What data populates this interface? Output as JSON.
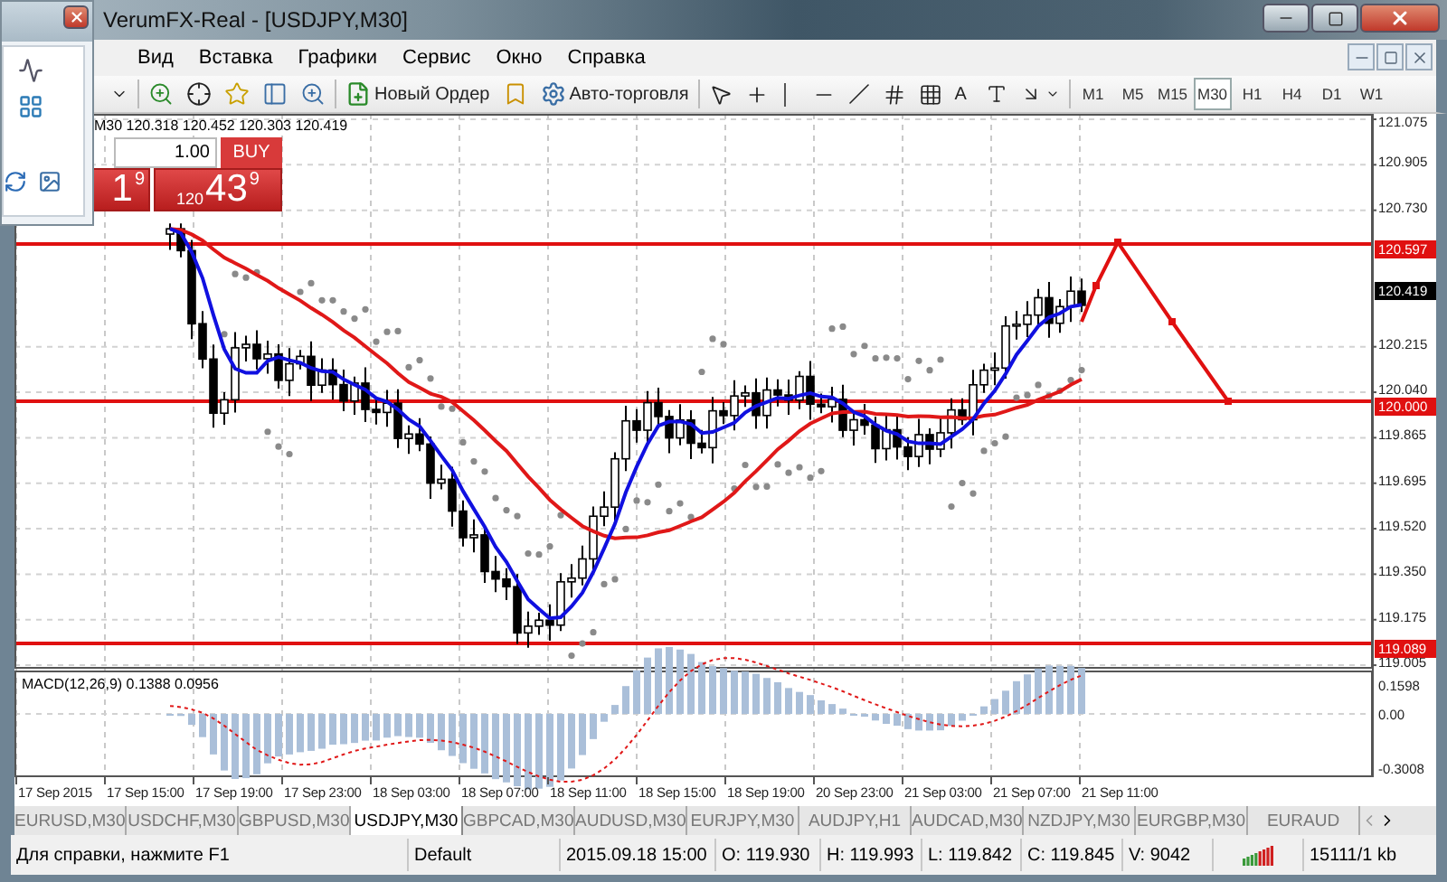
{
  "window": {
    "title": "VerumFX-Real - [USDJPY,M30]"
  },
  "menu": [
    "Вид",
    "Вставка",
    "Графики",
    "Сервис",
    "Окно",
    "Справка"
  ],
  "toolbar": {
    "new_order": "Новый Ордер",
    "auto_trading": "Авто-торговля",
    "text_tool": "A",
    "timeframes": [
      {
        "label": "M1",
        "selected": false
      },
      {
        "label": "M5",
        "selected": false
      },
      {
        "label": "M15",
        "selected": false
      },
      {
        "label": "M30",
        "selected": true
      },
      {
        "label": "H1",
        "selected": false
      },
      {
        "label": "H4",
        "selected": false
      },
      {
        "label": "D1",
        "selected": false
      },
      {
        "label": "W1",
        "selected": false
      }
    ]
  },
  "chart": {
    "info": "M30 120.318 120.452 120.303 120.419",
    "one_click": {
      "volume": "1.00",
      "buy_label": "BUY",
      "sell_price": {
        "big": "1",
        "pip": "9"
      },
      "buy_price": {
        "prefix": "120",
        "big": "43",
        "pip": "9"
      }
    },
    "price_ticks": [
      "121.075",
      "120.905",
      "120.730",
      "120.215",
      "120.040",
      "119.865",
      "119.695",
      "119.520",
      "119.350",
      "119.175",
      "119.005"
    ],
    "levels": [
      {
        "label": "120.597"
      },
      {
        "label": "120.000"
      },
      {
        "label": "119.089"
      }
    ],
    "current_price": "120.419",
    "time_labels": [
      "17 Sep 2015",
      "17 Sep 15:00",
      "17 Sep 19:00",
      "17 Sep 23:00",
      "18 Sep 03:00",
      "18 Sep 07:00",
      "18 Sep 11:00",
      "18 Sep 15:00",
      "18 Sep 19:00",
      "20 Sep 23:00",
      "21 Sep 03:00",
      "21 Sep 07:00",
      "21 Sep 11:00"
    ]
  },
  "macd": {
    "label": "MACD(12,26,9) 0.1388 0.0956",
    "ticks": [
      "0.1598",
      "0.00",
      "-0.3008"
    ]
  },
  "tabs": [
    {
      "label": "EURUSD,M30",
      "selected": false
    },
    {
      "label": "USDCHF,M30",
      "selected": false
    },
    {
      "label": "GBPUSD,M30",
      "selected": false
    },
    {
      "label": "USDJPY,M30",
      "selected": true
    },
    {
      "label": "GBPCAD,M30",
      "selected": false
    },
    {
      "label": "AUDUSD,M30",
      "selected": false
    },
    {
      "label": "EURJPY,M30",
      "selected": false
    },
    {
      "label": "AUDJPY,H1",
      "selected": false
    },
    {
      "label": "AUDCAD,M30",
      "selected": false
    },
    {
      "label": "NZDJPY,M30",
      "selected": false
    },
    {
      "label": "EURGBP,M30",
      "selected": false
    },
    {
      "label": "EURAUD",
      "selected": false
    }
  ],
  "status_bar": {
    "help": "Для справки, нажмите F1",
    "profile": "Default",
    "time": "2015.09.18 15:00",
    "open": "O: 119.930",
    "high": "H: 119.993",
    "low": "L: 119.842",
    "close": "C: 119.845",
    "volume": "V: 9042",
    "traffic": "15111/1 kb"
  }
}
